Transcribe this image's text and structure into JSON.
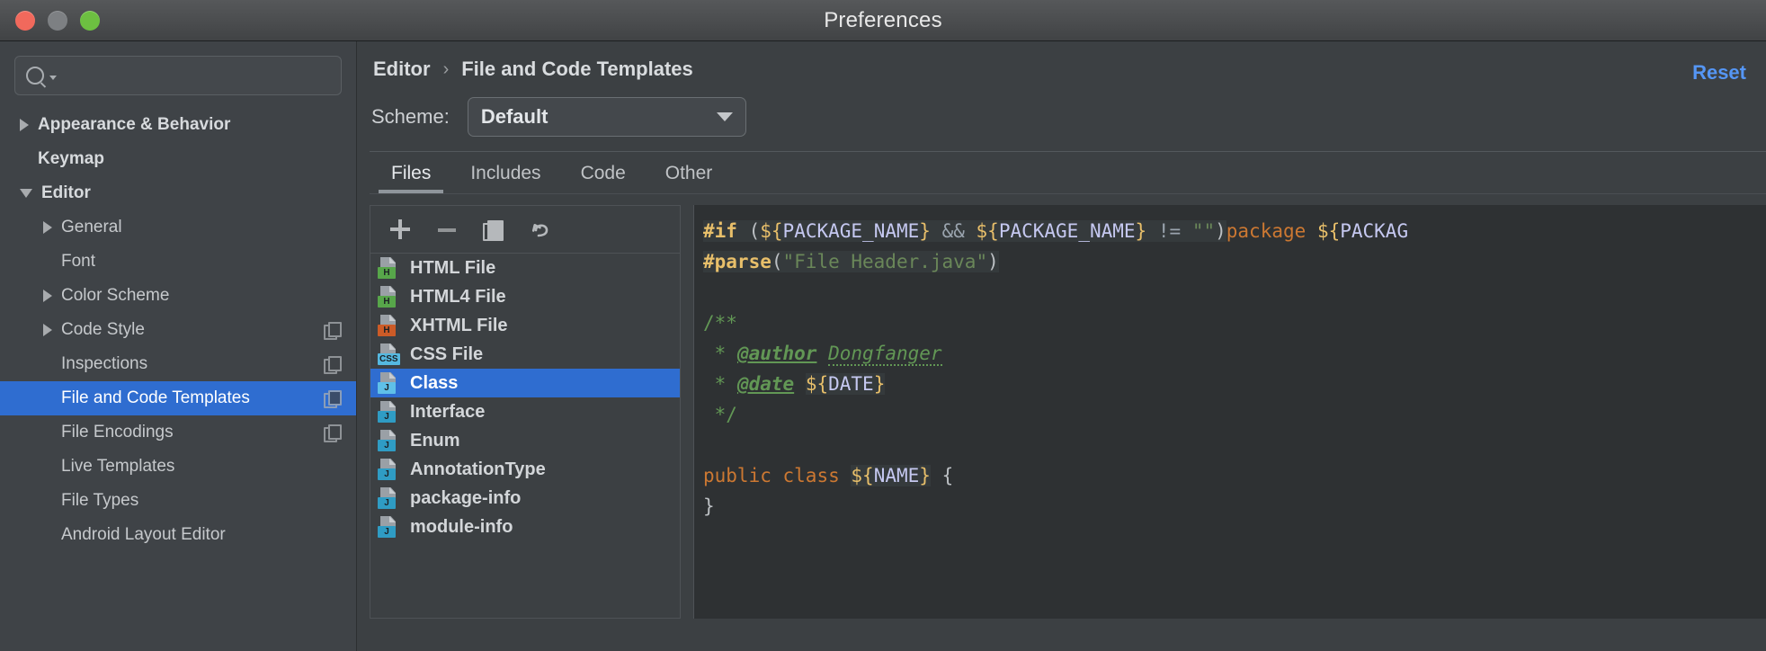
{
  "window": {
    "title": "Preferences",
    "traffic_lights": [
      "close",
      "minimize",
      "zoom"
    ]
  },
  "sidebar": {
    "search": {
      "value": "",
      "placeholder": ""
    },
    "items": [
      {
        "label": "Appearance & Behavior",
        "twisty": "closed",
        "indent": 0,
        "bold": true,
        "selected": false,
        "badge": false
      },
      {
        "label": "Keymap",
        "twisty": "none",
        "indent": 0,
        "bold": true,
        "selected": false,
        "badge": false
      },
      {
        "label": "Editor",
        "twisty": "open",
        "indent": 0,
        "bold": true,
        "selected": false,
        "badge": false
      },
      {
        "label": "General",
        "twisty": "closed",
        "indent": 1,
        "bold": false,
        "selected": false,
        "badge": false
      },
      {
        "label": "Font",
        "twisty": "none",
        "indent": 1,
        "bold": false,
        "selected": false,
        "badge": false
      },
      {
        "label": "Color Scheme",
        "twisty": "closed",
        "indent": 1,
        "bold": false,
        "selected": false,
        "badge": false
      },
      {
        "label": "Code Style",
        "twisty": "closed",
        "indent": 1,
        "bold": false,
        "selected": false,
        "badge": true
      },
      {
        "label": "Inspections",
        "twisty": "none",
        "indent": 1,
        "bold": false,
        "selected": false,
        "badge": true
      },
      {
        "label": "File and Code Templates",
        "twisty": "none",
        "indent": 1,
        "bold": false,
        "selected": true,
        "badge": true
      },
      {
        "label": "File Encodings",
        "twisty": "none",
        "indent": 1,
        "bold": false,
        "selected": false,
        "badge": true
      },
      {
        "label": "Live Templates",
        "twisty": "none",
        "indent": 1,
        "bold": false,
        "selected": false,
        "badge": false
      },
      {
        "label": "File Types",
        "twisty": "none",
        "indent": 1,
        "bold": false,
        "selected": false,
        "badge": false
      },
      {
        "label": "Android Layout Editor",
        "twisty": "none",
        "indent": 1,
        "bold": false,
        "selected": false,
        "badge": false
      }
    ]
  },
  "main": {
    "breadcrumb": {
      "parent": "Editor",
      "separator": "›",
      "current": "File and Code Templates"
    },
    "reset_label": "Reset",
    "scheme": {
      "label": "Scheme:",
      "value": "Default"
    },
    "tabs": [
      {
        "label": "Files",
        "active": true
      },
      {
        "label": "Includes",
        "active": false
      },
      {
        "label": "Code",
        "active": false
      },
      {
        "label": "Other",
        "active": false
      }
    ],
    "toolbar": [
      {
        "name": "add",
        "icon": "plus-icon"
      },
      {
        "name": "remove",
        "icon": "minus-icon"
      },
      {
        "name": "copy",
        "icon": "copy-icon"
      },
      {
        "name": "reset",
        "icon": "undo-icon"
      }
    ],
    "templates": [
      {
        "label": "HTML File",
        "tag": "H",
        "tag_color": "#57a64a",
        "selected": false
      },
      {
        "label": "HTML4 File",
        "tag": "H",
        "tag_color": "#57a64a",
        "selected": false
      },
      {
        "label": "XHTML File",
        "tag": "H",
        "tag_color": "#cc5b27",
        "selected": false
      },
      {
        "label": "CSS File",
        "tag": "CSS",
        "tag_color": "#55b8e0",
        "selected": false
      },
      {
        "label": "Class",
        "tag": "J",
        "tag_color": "#5fc0e8",
        "selected": true
      },
      {
        "label": "Interface",
        "tag": "J",
        "tag_color": "#2f9cc4",
        "selected": false
      },
      {
        "label": "Enum",
        "tag": "J",
        "tag_color": "#2f9cc4",
        "selected": false
      },
      {
        "label": "AnnotationType",
        "tag": "J",
        "tag_color": "#2f9cc4",
        "selected": false
      },
      {
        "label": "package-info",
        "tag": "J",
        "tag_color": "#2f9cc4",
        "selected": false
      },
      {
        "label": "module-info",
        "tag": "J",
        "tag_color": "#2f9cc4",
        "selected": false
      }
    ],
    "editor": {
      "lines": [
        "#if (${PACKAGE_NAME} && ${PACKAGE_NAME} != \"\")package ${PACKAGE_NAME};#end",
        "#parse(\"File Header.java\")",
        "",
        "/**",
        " * @author Dongfanger",
        " * @date ${DATE}",
        " */",
        "",
        "public class ${NAME} {",
        "}"
      ],
      "author": "Dongfanger",
      "date_var": "${DATE}",
      "name_var": "${NAME}",
      "header_file": "File Header.java"
    }
  },
  "colors": {
    "accent": "#2f6dd0",
    "link": "#5596f5",
    "window_bg": "#3c4043",
    "sidebar_bg": "#3f4347",
    "editor_bg": "#2e3133"
  }
}
